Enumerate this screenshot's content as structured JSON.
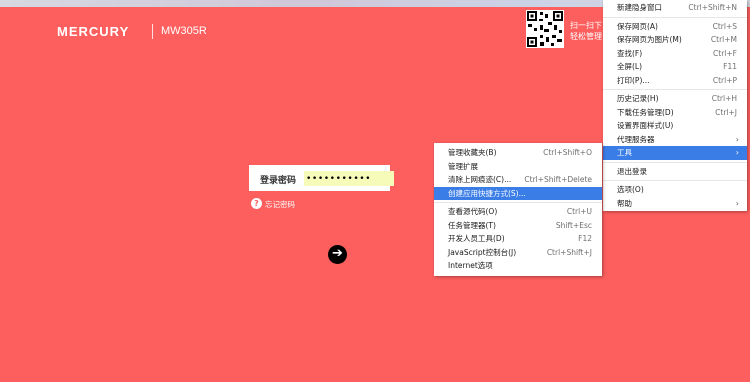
{
  "header": {
    "brand": "MERCURY",
    "model": "MW305R",
    "qr_text": "扫一扫下\n轻松管理"
  },
  "login": {
    "label": "登录密码",
    "password_value": "•••••••••••",
    "forgot": "忘记密码",
    "help_glyph": "?",
    "go_glyph": "➔"
  },
  "main_menu": {
    "items": [
      {
        "label": "新建隐身窗口",
        "shortcut": "Ctrl+Shift+N"
      },
      {
        "label": "保存网页(A)",
        "shortcut": "Ctrl+S"
      },
      {
        "label": "保存网页为图片(M)",
        "shortcut": "Ctrl+M"
      },
      {
        "label": "查找(F)",
        "shortcut": "Ctrl+F"
      },
      {
        "label": "全屏(L)",
        "shortcut": "F11"
      },
      {
        "label": "打印(P)...",
        "shortcut": "Ctrl+P"
      },
      {
        "label": "历史记录(H)",
        "shortcut": "Ctrl+H"
      },
      {
        "label": "下载任务管理(D)",
        "shortcut": "Ctrl+J"
      },
      {
        "label": "设置界面样式(U)",
        "shortcut": ""
      },
      {
        "label": "代理服务器",
        "shortcut": ""
      },
      {
        "label": "工具",
        "shortcut": ""
      },
      {
        "label": "退出登录",
        "shortcut": ""
      },
      {
        "label": "选项(O)",
        "shortcut": ""
      },
      {
        "label": "帮助",
        "shortcut": ""
      }
    ]
  },
  "tools_submenu": {
    "items": [
      {
        "label": "管理收藏夹(B)",
        "shortcut": "Ctrl+Shift+O"
      },
      {
        "label": "管理扩展",
        "shortcut": ""
      },
      {
        "label": "清除上网痕迹(C)...",
        "shortcut": "Ctrl+Shift+Delete"
      },
      {
        "label": "创建应用快捷方式(S)...",
        "shortcut": ""
      },
      {
        "label": "查看源代码(O)",
        "shortcut": "Ctrl+U"
      },
      {
        "label": "任务管理器(T)",
        "shortcut": "Shift+Esc"
      },
      {
        "label": "开发人员工具(D)",
        "shortcut": "F12"
      },
      {
        "label": "JavaScript控制台(J)",
        "shortcut": "Ctrl+Shift+J"
      },
      {
        "label": "Internet选项",
        "shortcut": ""
      }
    ]
  },
  "colors": {
    "background": "#fd5f5e",
    "highlight": "#3a7de6"
  }
}
